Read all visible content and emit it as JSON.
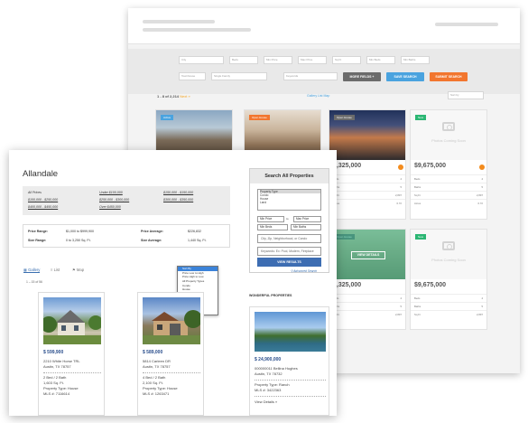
{
  "back": {
    "results_count": "1 - 8 of 2,214",
    "more_label": "Next »",
    "views": "Gallery  List  Map",
    "sort_placeholder": "Sort by",
    "filter_row1": [
      "City",
      "Beds",
      "Min Price",
      "Max Price",
      "Sq Ft",
      "Min Beds",
      "Min Baths"
    ],
    "filter_row2": [
      "Townhouse",
      "Single Family",
      "Keywords"
    ],
    "buttons": {
      "more": "MORE FIELDS +",
      "save": "SAVE SEARCH",
      "submit": "SUBMIT SEARCH"
    },
    "cards": [
      {
        "badge": "Active"
      },
      {
        "badge": "Open House"
      },
      {
        "badge": "Open House",
        "price": "4,325,000"
      },
      {
        "badge": "New",
        "price": "$9,675,000",
        "coming": "Photos Coming Soon"
      },
      {
        "badge": "Open House",
        "price": "4,325,000",
        "overlay": "VIEW DETAILS"
      },
      {
        "badge": "New",
        "price": "$9,675,000",
        "coming": "Photos Coming Soon"
      }
    ],
    "rows": [
      {
        "k": "Beds",
        "v": "4"
      },
      {
        "k": "Baths",
        "v": "5"
      },
      {
        "k": "Sq Ft",
        "v": "2,897"
      },
      {
        "k": "Acres",
        "v": "0.72"
      }
    ]
  },
  "front": {
    "title": "Allandale",
    "price_links": {
      "c1": [
        "All Prices",
        "$100,000 - $250,000",
        "$400,000 - $450,000"
      ],
      "c2": [
        "Under $100,000",
        "$250,000 - $300,000",
        "Over $450,000"
      ],
      "c3": [
        "$150,000 - $150,000",
        "$300,000 - $350,000",
        ""
      ]
    },
    "stats": {
      "price_range_label": "Price Range:",
      "price_range": "$1,000 to $999,900",
      "price_avg_label": "Price Average:",
      "price_avg": "$226,832",
      "size_range_label": "Size Range:",
      "size_range": "0 to 3,250 Sq. Ft.",
      "size_avg_label": "Size Average:",
      "size_avg": "1,440 Sq. Ft."
    },
    "view_tabs": [
      "Gallery",
      "List",
      "Map"
    ],
    "count": "1 – 15 of 56",
    "sort_options": [
      "Sort By",
      "Price Low to High",
      "Price High to Low",
      "All Property Types",
      "Condo",
      "House",
      "Land",
      "Hotel",
      "Multi",
      "Other",
      "Ranch"
    ],
    "listings": [
      {
        "price": "$ 599,900",
        "addr1": "2210 White Horse TRL",
        "addr2": "Austin, TX 78757",
        "beds": "2 Bed / 2 Bath",
        "sqft": "1,603 Sq. Ft.",
        "type": "Property Type: House",
        "mls": "MLS #: 7116614"
      },
      {
        "price": "$ 589,000",
        "addr1": "5814 Carleen DR",
        "addr2": "Austin, TX 78757",
        "beds": "4 Bed / 2 Bath",
        "sqft": "2,100 Sq. Ft.",
        "type": "Property Type: House",
        "mls": "MLS #: 1263471"
      }
    ],
    "search": {
      "heading": "Search All Properties",
      "types": [
        "Property Type",
        "Condo",
        "House",
        "Land"
      ],
      "min_price": "Min Price",
      "to": "to",
      "max_price": "Max Price",
      "min_beds": "Min Beds",
      "min_baths": "Min Baths",
      "city_placeholder": "City, Zip, Neighborhood, or Condo",
      "keyword_placeholder": "Keywords: Ex: Pool, Modern, Fireplace",
      "button": "VIEW RESULTS",
      "advanced": "Advanced Search"
    },
    "featured": {
      "heading": "WONDERFUL PROPERTIES",
      "price": "$ 24,900,000",
      "addr1": "000000011 Bellina Hughes",
      "addr2": "Austin, TX 78732",
      "type": "Property Type: Ranch",
      "mls": "MLS #: 3422363",
      "details": "View Details »"
    }
  }
}
